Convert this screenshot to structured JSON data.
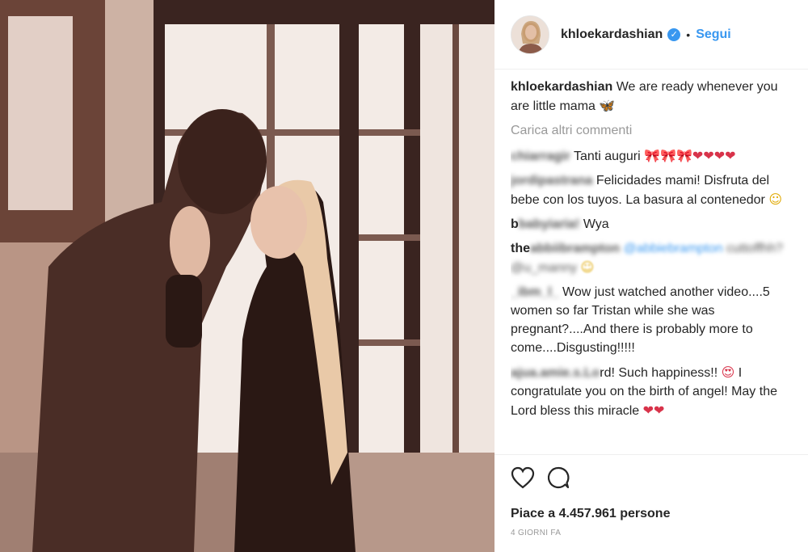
{
  "header": {
    "username": "khloekardashian",
    "verified_mark": "✓",
    "separator": "•",
    "follow_label": "Segui"
  },
  "caption": {
    "username": "khloekardashian",
    "text": "We are ready whenever you are little mama",
    "emoji": "🦋"
  },
  "load_more_label": "Carica altri commenti",
  "comments": [
    {
      "user_blurred": "chiarragir",
      "text": "Tanti auguri",
      "emoji": "🎀🎀🎀❤❤❤❤"
    },
    {
      "user_blurred": "jordipastrana",
      "text": "Felicidades mami! Disfruta del bebe con los tuyos. La basura al contenedor",
      "emoji": "☺"
    },
    {
      "user_blurred": "babyiaria!",
      "user_visible": "b",
      "text": "Wya",
      "emoji": ""
    },
    {
      "user_visible": "the",
      "user_blurred": "abbiibrampton",
      "mention": "@abbiebrampton",
      "text_blurred": "cuttoffhh? @u_manny",
      "emoji": "☺"
    },
    {
      "user_blurred": "_ibm_l_",
      "text": "Wow just watched another video....5 women so far Tristan while she was pregnant?....And there is probably more to come....Disgusting!!!!!",
      "emoji": ""
    },
    {
      "user_blurred": "ajua.amie.s.Lo",
      "text": "rd! Such happiness!!",
      "emoji": "😍",
      "text2": "I congratulate you on the birth of angel! May the Lord bless this miracle",
      "emoji2": "❤❤"
    }
  ],
  "actions": {
    "like_icon": "heart-icon",
    "comment_icon": "comment-icon",
    "likes_text": "Piace a 4.457.961 persone",
    "time_ago": "4 GIORNI FA"
  }
}
